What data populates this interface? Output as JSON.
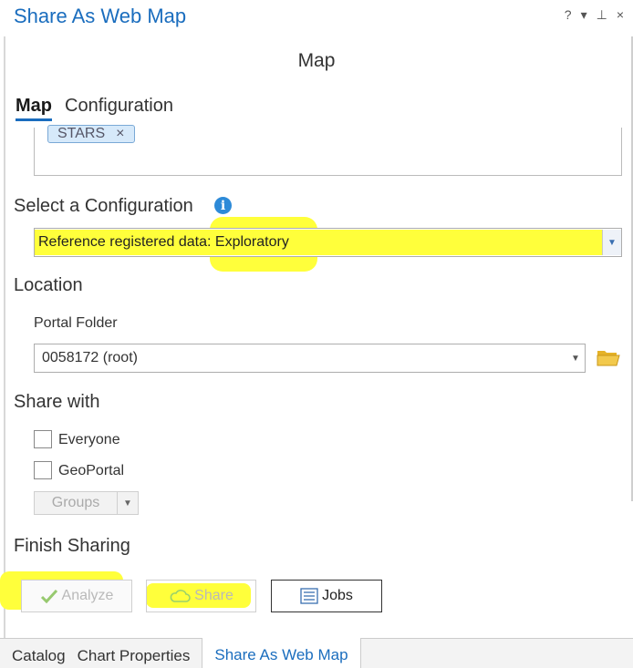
{
  "window": {
    "title": "Share As Web Map",
    "controls": {
      "help": "?",
      "menu": "▾",
      "pin": "⊥",
      "close": "×"
    }
  },
  "header": {
    "title": "Map"
  },
  "tabs": [
    {
      "label": "Map",
      "active": true
    },
    {
      "label": "Configuration",
      "active": false
    }
  ],
  "tags": {
    "items": [
      {
        "label": "STARS",
        "remove": "×"
      }
    ]
  },
  "configuration": {
    "heading": "Select a Configuration",
    "info_icon": "i",
    "selected": "Reference registered data: Exploratory"
  },
  "location": {
    "heading": "Location",
    "portal_folder_label": "Portal Folder",
    "portal_folder_value": "0058172 (root)"
  },
  "share_with": {
    "heading": "Share with",
    "options": [
      {
        "label": "Everyone",
        "checked": false
      },
      {
        "label": "GeoPortal",
        "checked": false
      }
    ],
    "groups_label": "Groups"
  },
  "finish": {
    "heading": "Finish Sharing",
    "analyze_label": "Analyze",
    "share_label": "Share",
    "jobs_label": "Jobs"
  },
  "bottom_tabs": [
    {
      "label": "Catalog",
      "active": false
    },
    {
      "label": "Chart Properties",
      "active": false
    },
    {
      "label": "Share As Web Map",
      "active": true
    }
  ],
  "colors": {
    "accent": "#1a6dbe",
    "highlight": "#ffff3b",
    "info": "#2d8ad8"
  }
}
